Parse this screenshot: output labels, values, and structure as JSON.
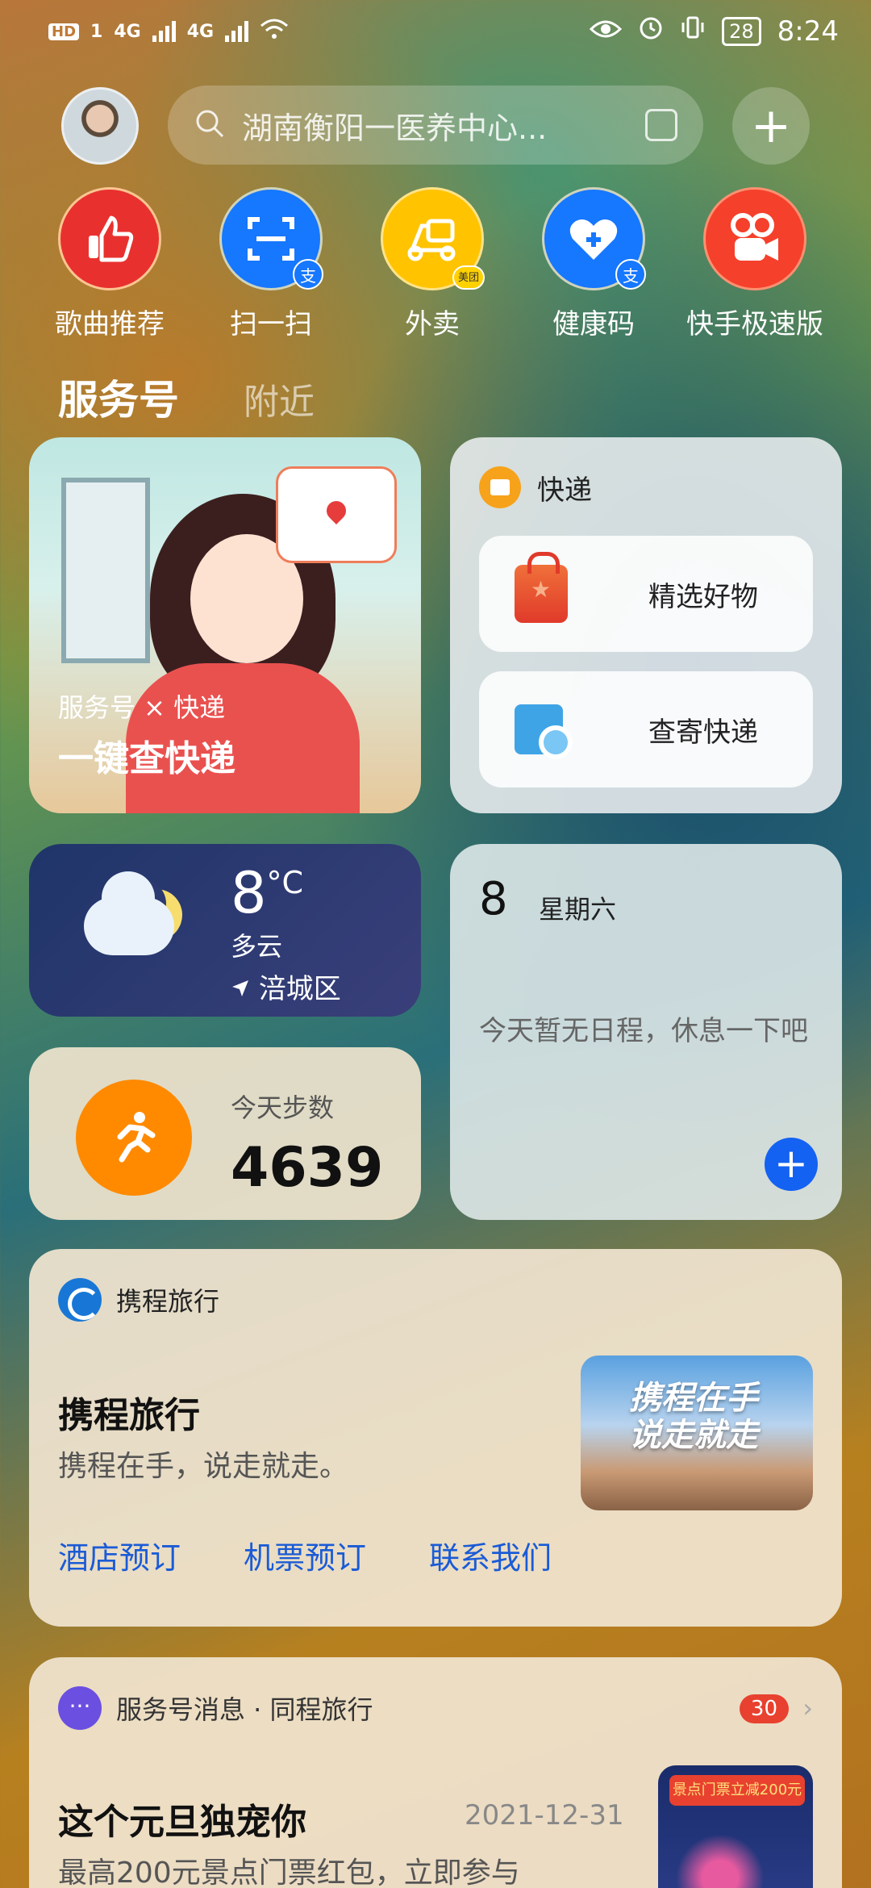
{
  "status_bar": {
    "hd": "HD",
    "sim": "1",
    "net1": "4G",
    "net2": "4G",
    "battery": "28",
    "time": "8:24"
  },
  "search": {
    "placeholder": "湖南衡阳一医养中心..."
  },
  "apps": [
    {
      "label": "歌曲推荐",
      "icon": "thumbs-up-icon",
      "color": "#e8312f"
    },
    {
      "label": "扫一扫",
      "icon": "scan-icon",
      "color": "#1677ff",
      "badge": "支"
    },
    {
      "label": "外卖",
      "icon": "scooter-icon",
      "color": "#ffc300",
      "badge": "美团"
    },
    {
      "label": "健康码",
      "icon": "heart-plus-icon",
      "color": "#1677ff",
      "badge": "支"
    },
    {
      "label": "快手极速版",
      "icon": "kuaishou-icon",
      "color": "#f5402b"
    }
  ],
  "tabs": {
    "main": "服务号",
    "nearby": "附近"
  },
  "express_banner": {
    "subtitle": "服务号 × 快递",
    "title": "一键查快递"
  },
  "express_card": {
    "title": "快递",
    "buttons": [
      {
        "label": "精选好物"
      },
      {
        "label": "查寄快递"
      }
    ]
  },
  "weather": {
    "temp": "8",
    "unit": "°C",
    "condition": "多云",
    "location": "涪城区"
  },
  "calendar": {
    "day": "8",
    "weekday": "星期六",
    "empty_text": "今天暂无日程，休息一下吧"
  },
  "steps": {
    "label": "今天步数",
    "count": "4639"
  },
  "ctrip": {
    "header": "携程旅行",
    "title": "携程旅行",
    "desc": "携程在手，说走就走。",
    "thumb_text_1": "携程在手",
    "thumb_text_2": "说走就走",
    "links": [
      "酒店预订",
      "机票预订",
      "联系我们"
    ]
  },
  "message": {
    "header": "服务号消息 · 同程旅行",
    "count": "30",
    "title": "这个元旦独宠你",
    "date": "2021-12-31",
    "desc": "最高200元景点门票红包，立即参与",
    "thumb_banner": "景点门票立减200元"
  }
}
